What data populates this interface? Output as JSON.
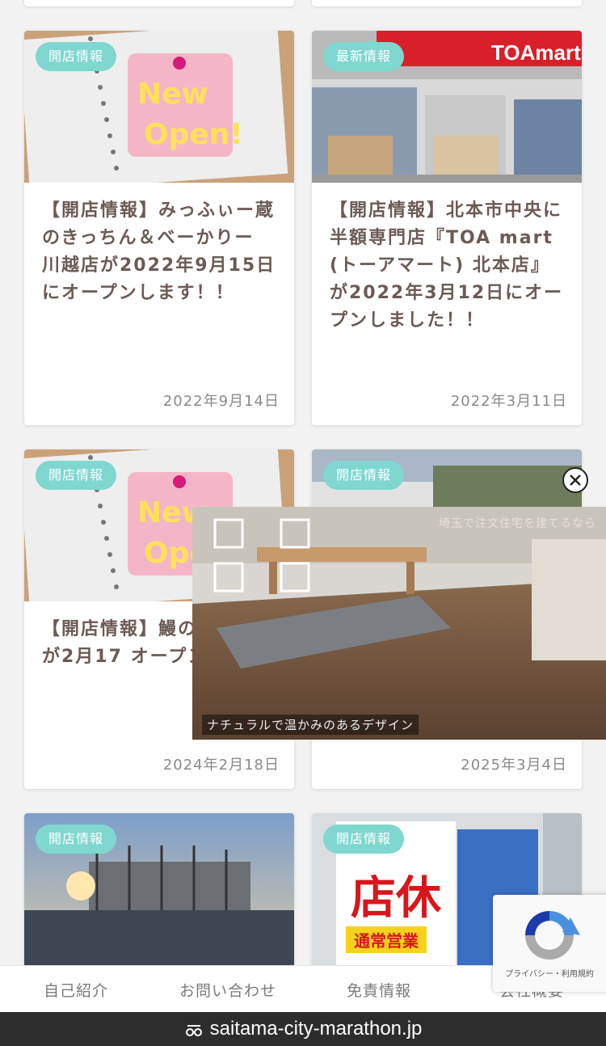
{
  "cards": [
    {
      "badge": "開店情報",
      "title": "【開店情報】みっふぃー蔵のきっちん＆べーかりー 川越店が2022年9月15日にオープンします！！",
      "date": "2022年9月14日",
      "thumb": "notebook-newopen-photo"
    },
    {
      "badge": "最新情報",
      "title": "【開店情報】北本市中央に半額専門店『TOA mart (トーアマート) 北本店』が2022年3月12日にオープンしました！！",
      "date": "2022年3月11日",
      "thumb": "toamart-storefront-photo",
      "sign": "TOAmart"
    },
    {
      "badge": "開店情報",
      "title": "【開店情報】鰻の 川越店が2月17 オープン！！",
      "date": "2024年2月18日",
      "thumb": "notebook-newopen-photo"
    },
    {
      "badge": "開店情報",
      "title": "",
      "date": "2025年3月4日",
      "thumb": "street-photo"
    },
    {
      "badge": "開店情報",
      "title": "",
      "date": "",
      "thumb": "construction-site-photo"
    },
    {
      "badge": "開店情報",
      "title": "",
      "date": "",
      "thumb": "closed-notice-photo",
      "sign": "店休",
      "sign2": "通常営業"
    }
  ],
  "video_ad": {
    "caption": "ナチュラルで温かみのあるデザイン",
    "overlay_title": "埼玉で注文住宅を建てるなら"
  },
  "footer_nav": [
    "自己紹介",
    "お問い合わせ",
    "免責情報",
    "会社概要"
  ],
  "recaptcha": {
    "links": "プライバシー・利用規約"
  },
  "url_bar": {
    "domain": "saitama-city-marathon.jp"
  },
  "colors": {
    "badge": "#7fd7cf",
    "title": "#6b5a55",
    "url_bar": "#2d2d2d"
  }
}
